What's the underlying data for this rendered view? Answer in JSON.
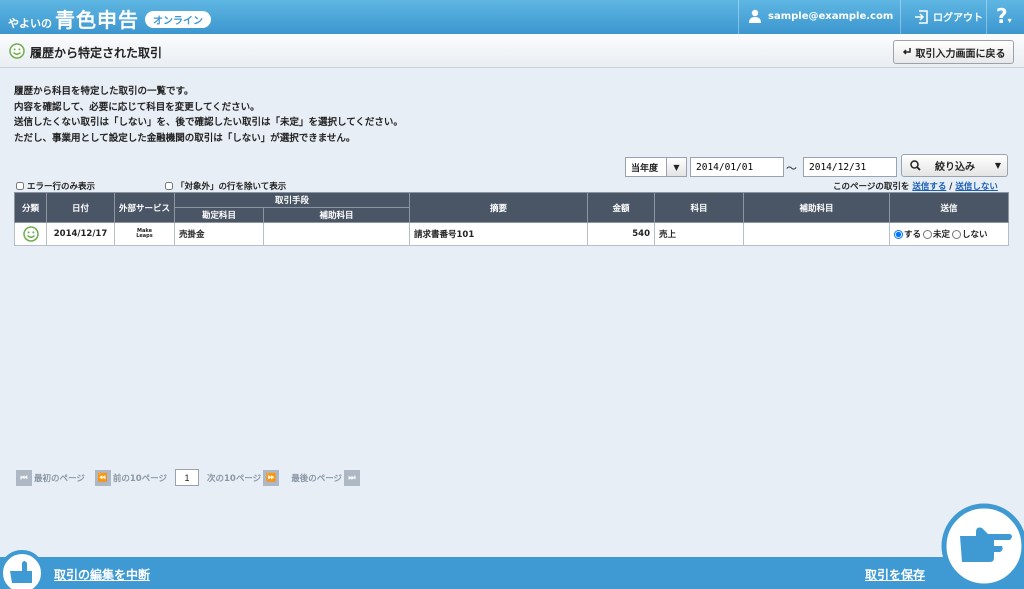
{
  "app": {
    "logo_sub": "やよいの",
    "logo_main": "青色申告",
    "logo_badge": "オンライン",
    "user_email": "sample@example.com",
    "logout_label": "ログアウト",
    "help_label": "?"
  },
  "page": {
    "title": "履歴から特定された取引",
    "back_button": "取引入力画面に戻る"
  },
  "description": [
    "履歴から科目を特定した取引の一覧です。",
    "内容を確認して、必要に応じて科目を変更してください。",
    "送信したくない取引は「しない」を、後で確認したい取引は「未定」を選択してください。",
    "ただし、事業用として設定した金融機関の取引は「しない」が選択できません。"
  ],
  "filter": {
    "period_select": "当年度",
    "date_from": "2014/01/01",
    "tilde": "〜",
    "date_to": "2014/12/31",
    "filter_button": "絞り込み"
  },
  "options": {
    "error_only": "エラー行のみ表示",
    "exclude_outside": "「対象外」の行を除いて表示",
    "page_send_prefix": "このページの取引を",
    "send_all": "送信する",
    "slash": "/",
    "send_none": "送信しない"
  },
  "table": {
    "headers": {
      "category": "分類",
      "date": "日付",
      "external_service": "外部サービス",
      "method": "取引手段",
      "account": "勘定科目",
      "sub_account": "補助科目",
      "summary": "摘要",
      "amount": "金額",
      "subject": "科目",
      "sub_subject": "補助科目",
      "send": "送信"
    },
    "rows": [
      {
        "date": "2014/12/17",
        "external_service_logo_line1": "Make",
        "external_service_logo_line2": "Leaps",
        "account": "売掛金",
        "sub_account": "",
        "summary": "請求書番号101",
        "amount": "540",
        "subject": "売上",
        "sub_subject": "",
        "send_options": [
          "する",
          "未定",
          "しない"
        ],
        "send_selected": "する"
      }
    ]
  },
  "pager": {
    "first": "最初のページ",
    "prev": "前の10ページ",
    "current": "1",
    "next": "次の10ページ",
    "last": "最後のページ"
  },
  "footer": {
    "abort": "取引の編集を中断",
    "save": "取引を保存"
  },
  "colors": {
    "topbar": "#4aa6da",
    "table_header": "#4a5565",
    "link": "#1a5fb4",
    "smile": "#6ab04c"
  }
}
